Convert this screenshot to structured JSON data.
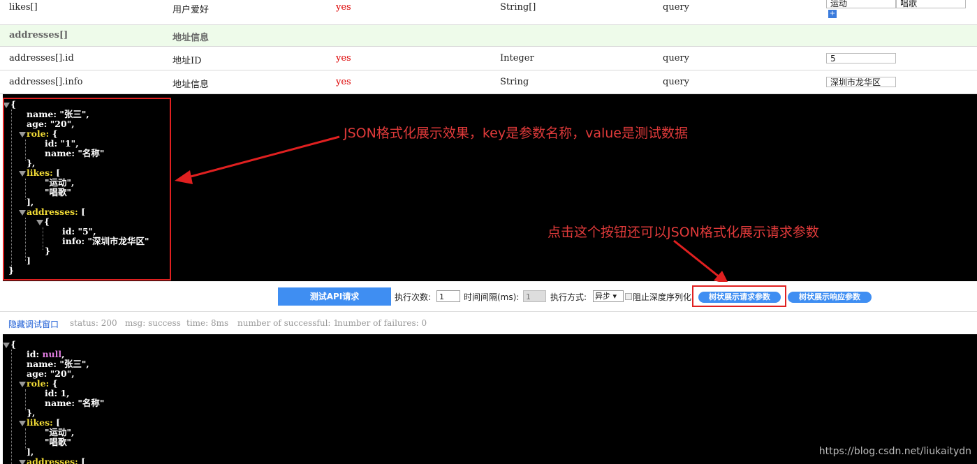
{
  "table": {
    "rows": [
      {
        "name": "likes[]",
        "desc": "用户爱好",
        "required": "yes",
        "type": "String[]",
        "in": "query",
        "values": [
          "运动",
          "唱歌"
        ]
      },
      {
        "name": "addresses[]",
        "desc": "地址信息"
      },
      {
        "name": "addresses[].id",
        "desc": "地址ID",
        "required": "yes",
        "type": "Integer",
        "in": "query",
        "value": "5"
      },
      {
        "name": "addresses[].info",
        "desc": "地址信息",
        "required": "yes",
        "type": "String",
        "in": "query",
        "value": "深圳市龙华区"
      }
    ],
    "add_label": "+"
  },
  "request_json": {
    "open": "{",
    "close": "}",
    "name_key": "name:",
    "name_val": "\"张三\",",
    "age_key": "age:",
    "age_val": "\"20\",",
    "role_key": "role:",
    "role_open": "{",
    "role_id_key": "id:",
    "role_id_val": "\"1\",",
    "role_name_key": "name:",
    "role_name_val": "\"名称\"",
    "role_close": "},",
    "likes_key": "likes:",
    "likes_open": "[",
    "like1": "\"运动\",",
    "like2": "\"唱歌\"",
    "likes_close": "],",
    "addr_key": "addresses:",
    "addr_open": "[",
    "addr_item_open": "{",
    "addr_id_key": "id:",
    "addr_id_val": "\"5\",",
    "addr_info_key": "info:",
    "addr_info_val": "\"深圳市龙华区\"",
    "addr_item_close": "}",
    "addr_close": "]"
  },
  "annotations": {
    "json_note": "JSON格式化展示效果，key是参数名称，value是测试数据",
    "button_note": "点击这个按钮还可以JSON格式化展示请求参数"
  },
  "toolbar": {
    "test_button": "测试API请求",
    "exec_count_label": "执行次数:",
    "exec_count": "1",
    "interval_label": "时间间隔(ms):",
    "interval": "1",
    "mode_label": "执行方式:",
    "mode": "异步 ▾",
    "deep_serialize_label": "阻止深度序列化",
    "tree_request_button": "树状展示请求参数",
    "tree_response_button": "树状展示响应参数"
  },
  "status": {
    "hide_link": "隐藏调试窗口",
    "status": "status: 200",
    "msg": "msg: success",
    "time": "time: 8ms",
    "successful": "number of successful: 1",
    "failures": "number of failures: 0"
  },
  "response_json": {
    "open": "{",
    "id_key": "id:",
    "id_val": "null",
    ",": ",",
    "name_key": "name:",
    "name_val": "\"张三\",",
    "age_key": "age:",
    "age_val": "\"20\",",
    "role_key": "role:",
    "role_open": "{",
    "role_id_key": "id:",
    "role_id_val": "1,",
    "role_name_key": "name:",
    "role_name_val": "\"名称\"",
    "role_close": "},",
    "likes_key": "likes:",
    "likes_open": "[",
    "like1": "\"运动\",",
    "like2": "\"唱歌\"",
    "likes_close": "],",
    "addr_key": "addresses:",
    "addr_open": "["
  },
  "watermark": "https://blog.csdn.net/liukaitydn",
  "colors": {
    "accent": "#3f8ef2",
    "annotation": "#e02020",
    "json_key_obj": "#f2dc36",
    "json_null": "#e07ce0"
  }
}
